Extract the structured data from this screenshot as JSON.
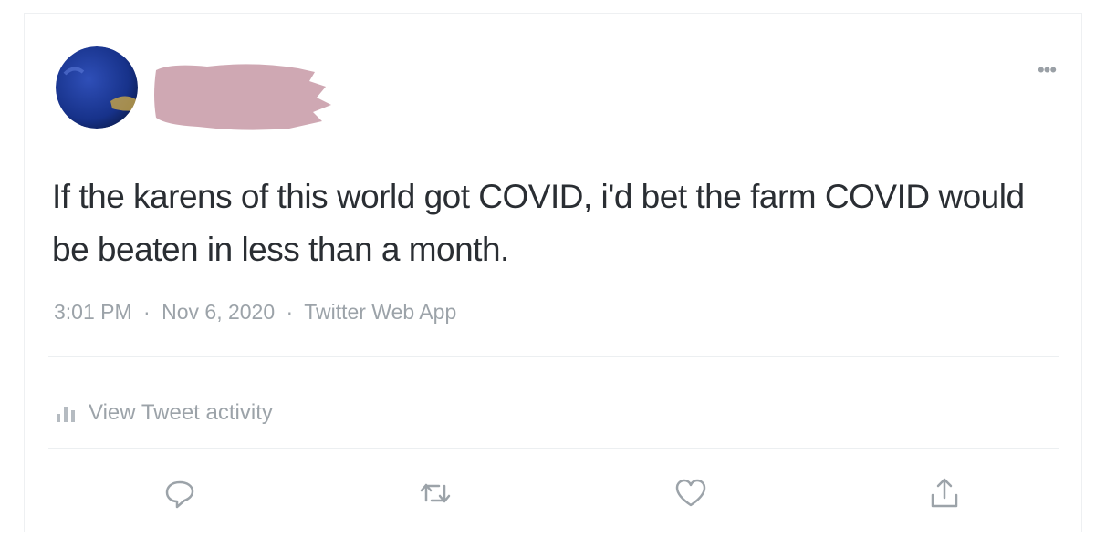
{
  "tweet": {
    "text": "If the karens of this world got COVID, i'd bet the farm COVID would be beaten in less than a month.",
    "time": "3:01 PM",
    "date": "Nov 6, 2020",
    "source": "Twitter Web App",
    "separator": "·"
  },
  "activity": {
    "label": "View Tweet activity",
    "icon": "bar-chart-icon"
  },
  "actions": [
    {
      "icon": "reply-icon"
    },
    {
      "icon": "retweet-icon"
    },
    {
      "icon": "like-icon"
    },
    {
      "icon": "share-icon"
    }
  ],
  "header": {
    "more_icon": "more-horizontal-icon",
    "more_glyph": "•••"
  },
  "colors": {
    "text": "#2a2e33",
    "muted": "#9ca3a9",
    "redaction": "#cfa8b3",
    "avatar": "#1e3a8a"
  }
}
